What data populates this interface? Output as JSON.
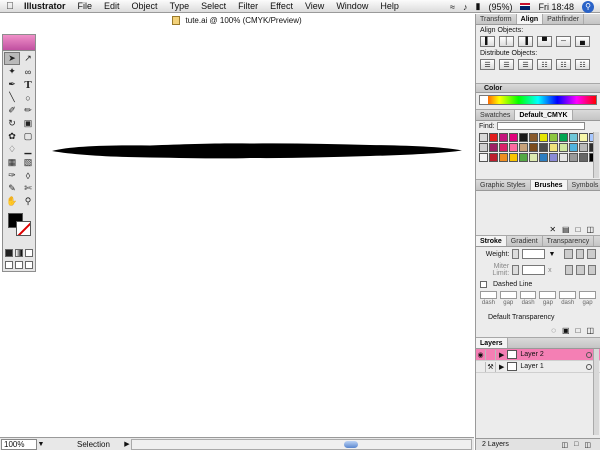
{
  "menubar": {
    "apple_icon": "apple-icon",
    "app_name": "Illustrator",
    "items": [
      "File",
      "Edit",
      "Object",
      "Type",
      "Select",
      "Filter",
      "Effect",
      "View",
      "Window",
      "Help"
    ],
    "battery": "(95%)",
    "clock": "Fri 18:48"
  },
  "document": {
    "title": "tute.ai @ 100% (CMYK/Preview)"
  },
  "align": {
    "tabs": [
      "Transform",
      "Align",
      "Pathfinder"
    ],
    "active_tab": "Align",
    "align_objects_label": "Align Objects:",
    "distribute_objects_label": "Distribute Objects:"
  },
  "color": {
    "title": "Color"
  },
  "swatches": {
    "tabs": [
      "Swatches",
      "Default_CMYK"
    ],
    "find_label": "Find:",
    "colors": [
      "#d9d9d9",
      "#e21d1d",
      "#c4137c",
      "#e0007a",
      "#1a1a1a",
      "#8a5a2b",
      "#e4e400",
      "#8cc63e",
      "#00a651",
      "#6ec7d8",
      "#f6f6a8",
      "#a8c8ff",
      "#cfcfcf",
      "#9e1f63",
      "#d92168",
      "#ff6aa0",
      "#c9a27a",
      "#7c4a1c",
      "#4b4b4b",
      "#f0e27b",
      "#cfe7a0",
      "#4fb3e0",
      "#b9b9b9",
      "#2f2f2f",
      "#f3f3f3",
      "#bd1e2d",
      "#ee8e21",
      "#f8c300",
      "#54a844",
      "#ddeab0",
      "#2d7ec1",
      "#8a8ad6",
      "#e5e5e5",
      "#999999",
      "#666666",
      "#000000"
    ]
  },
  "brushes": {
    "tabs": [
      "Graphic Styles",
      "Brushes",
      "Symbols"
    ],
    "active_tab": "Brushes"
  },
  "stroke": {
    "tabs": [
      "Stroke",
      "Gradient",
      "Transparency"
    ],
    "active_tab": "Stroke",
    "weight_label": "Weight:",
    "miter_label": "Miter Limit:",
    "miter_suffix": "x",
    "dashed_line_label": "Dashed Line",
    "dash_labels": [
      "dash",
      "gap",
      "dash",
      "gap",
      "dash",
      "gap"
    ],
    "transparency_label": "Default Transparency"
  },
  "layers": {
    "tab": "Layers",
    "items": [
      {
        "name": "Layer 2",
        "selected": true
      },
      {
        "name": "Layer 1",
        "selected": false
      }
    ],
    "footer": "2 Layers"
  },
  "status": {
    "zoom": "100%",
    "tool": "Selection"
  },
  "colors": {
    "selection_pink": "#f47fb4",
    "stroke_black": "#000000"
  }
}
